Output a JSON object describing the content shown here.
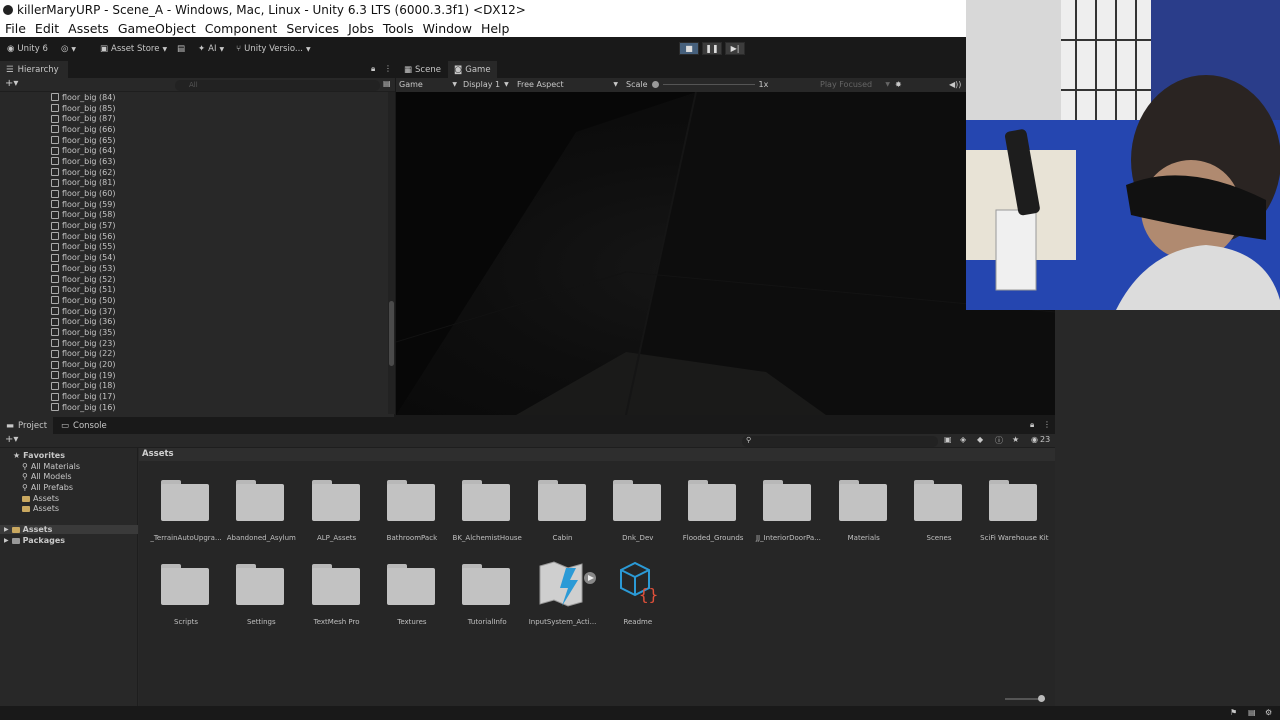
{
  "title": "killerMaryURP - Scene_A - Windows, Mac, Linux - Unity 6.3 LTS (6000.3.3f1) <DX12>",
  "menu": [
    "File",
    "Edit",
    "Assets",
    "GameObject",
    "Component",
    "Services",
    "Jobs",
    "Tools",
    "Window",
    "Help"
  ],
  "toolbar": {
    "account": "Unity 6",
    "asset_store": "Asset Store",
    "ai": "AI",
    "version_control": "Unity Versio..."
  },
  "hierarchy": {
    "tab": "Hierarchy",
    "search_placeholder": "All",
    "items": [
      "floor_big (84)",
      "floor_big (85)",
      "floor_big (87)",
      "floor_big (66)",
      "floor_big (65)",
      "floor_big (64)",
      "floor_big (63)",
      "floor_big (62)",
      "floor_big (81)",
      "floor_big (60)",
      "floor_big (59)",
      "floor_big (58)",
      "floor_big (57)",
      "floor_big (56)",
      "floor_big (55)",
      "floor_big (54)",
      "floor_big (53)",
      "floor_big (52)",
      "floor_big (51)",
      "floor_big (50)",
      "floor_big (37)",
      "floor_big (36)",
      "floor_big (35)",
      "floor_big (23)",
      "floor_big (22)",
      "floor_big (20)",
      "floor_big (19)",
      "floor_big (18)",
      "floor_big (17)",
      "floor_big (16)"
    ]
  },
  "game_view": {
    "tabs": [
      "Scene",
      "Game"
    ],
    "active_tab": "Game",
    "mode": "Game",
    "display": "Display 1",
    "aspect": "Free Aspect",
    "scale_label": "Scale",
    "scale_value": "1x",
    "play_focus": "Play Focused"
  },
  "project": {
    "tabs": [
      "Project",
      "Console"
    ],
    "item_count": "23",
    "favorites_label": "Favorites",
    "favorites": [
      "All Materials",
      "All Models",
      "All Prefabs",
      "Assets",
      "Assets"
    ],
    "roots": [
      "Assets",
      "Packages"
    ],
    "breadcrumb": "Assets",
    "assets": [
      {
        "name": "_TerrainAutoUpgra...",
        "kind": "folder"
      },
      {
        "name": "Abandoned_Asylum",
        "kind": "folder"
      },
      {
        "name": "ALP_Assets",
        "kind": "folder"
      },
      {
        "name": "BathroomPack",
        "kind": "folder"
      },
      {
        "name": "BK_AlchemistHouse",
        "kind": "folder"
      },
      {
        "name": "Cabin",
        "kind": "folder"
      },
      {
        "name": "Dnk_Dev",
        "kind": "folder"
      },
      {
        "name": "Flooded_Grounds",
        "kind": "folder"
      },
      {
        "name": "JJ_InteriorDoorPa...",
        "kind": "folder"
      },
      {
        "name": "Materials",
        "kind": "folder"
      },
      {
        "name": "Scenes",
        "kind": "folder"
      },
      {
        "name": "SciFi Warehouse Kit",
        "kind": "folder"
      },
      {
        "name": "Scripts",
        "kind": "folder"
      },
      {
        "name": "Settings",
        "kind": "folder"
      },
      {
        "name": "TextMesh Pro",
        "kind": "folder"
      },
      {
        "name": "Textures",
        "kind": "folder"
      },
      {
        "name": "TutorialInfo",
        "kind": "folder"
      },
      {
        "name": "InputSystem_Acti...",
        "kind": "input-actions"
      },
      {
        "name": "Readme",
        "kind": "readme"
      }
    ]
  },
  "colors": {
    "folder": "#c2c2c2",
    "accent": "#46607c",
    "panel": "#282828"
  }
}
